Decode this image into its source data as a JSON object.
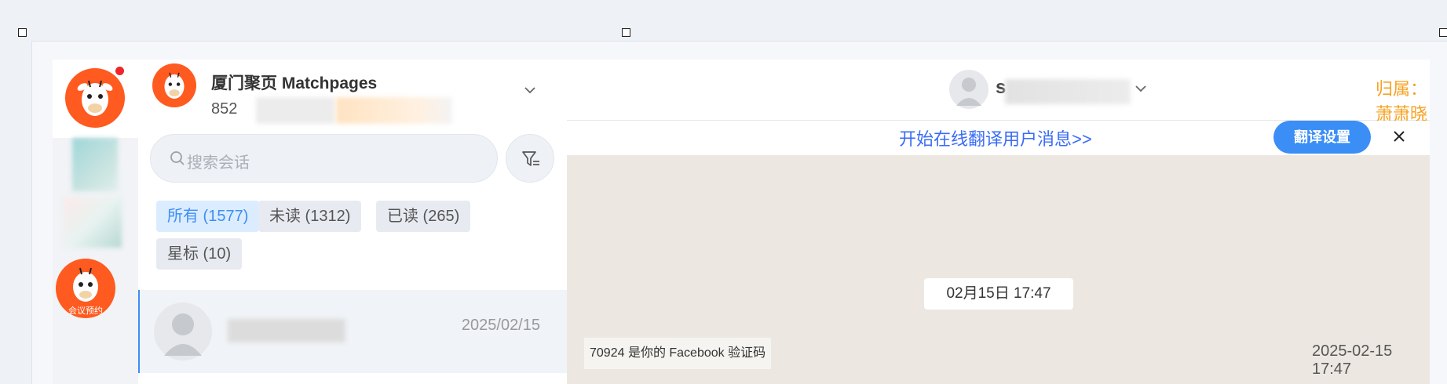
{
  "account": {
    "name": "厦门聚页 Matchpages",
    "phone_prefix": "852"
  },
  "search": {
    "placeholder": "搜索会话"
  },
  "filters": {
    "all": "所有 (1577)",
    "unread": "未读 (1312)",
    "read": "已读 (265)",
    "starred": "星标 (10)"
  },
  "conversation": {
    "date": "2025/02/15"
  },
  "chat": {
    "contact_initial": "s",
    "owner": "归属：萧萧晓",
    "translate_link": "开始在线翻译用户消息>>",
    "translate_button": "翻译设置",
    "date_divider": "02月15日 17:47",
    "message_text": "70924 是你的 Facebook 验证码",
    "message_time": "2025-02-15 17:47"
  },
  "rail": {
    "badge_text": "会议预约"
  },
  "colors": {
    "accent": "#3a8ef6",
    "brand_orange": "#ff5a1f",
    "owner_orange": "#f7a222",
    "link_blue": "#3a6cf6"
  }
}
